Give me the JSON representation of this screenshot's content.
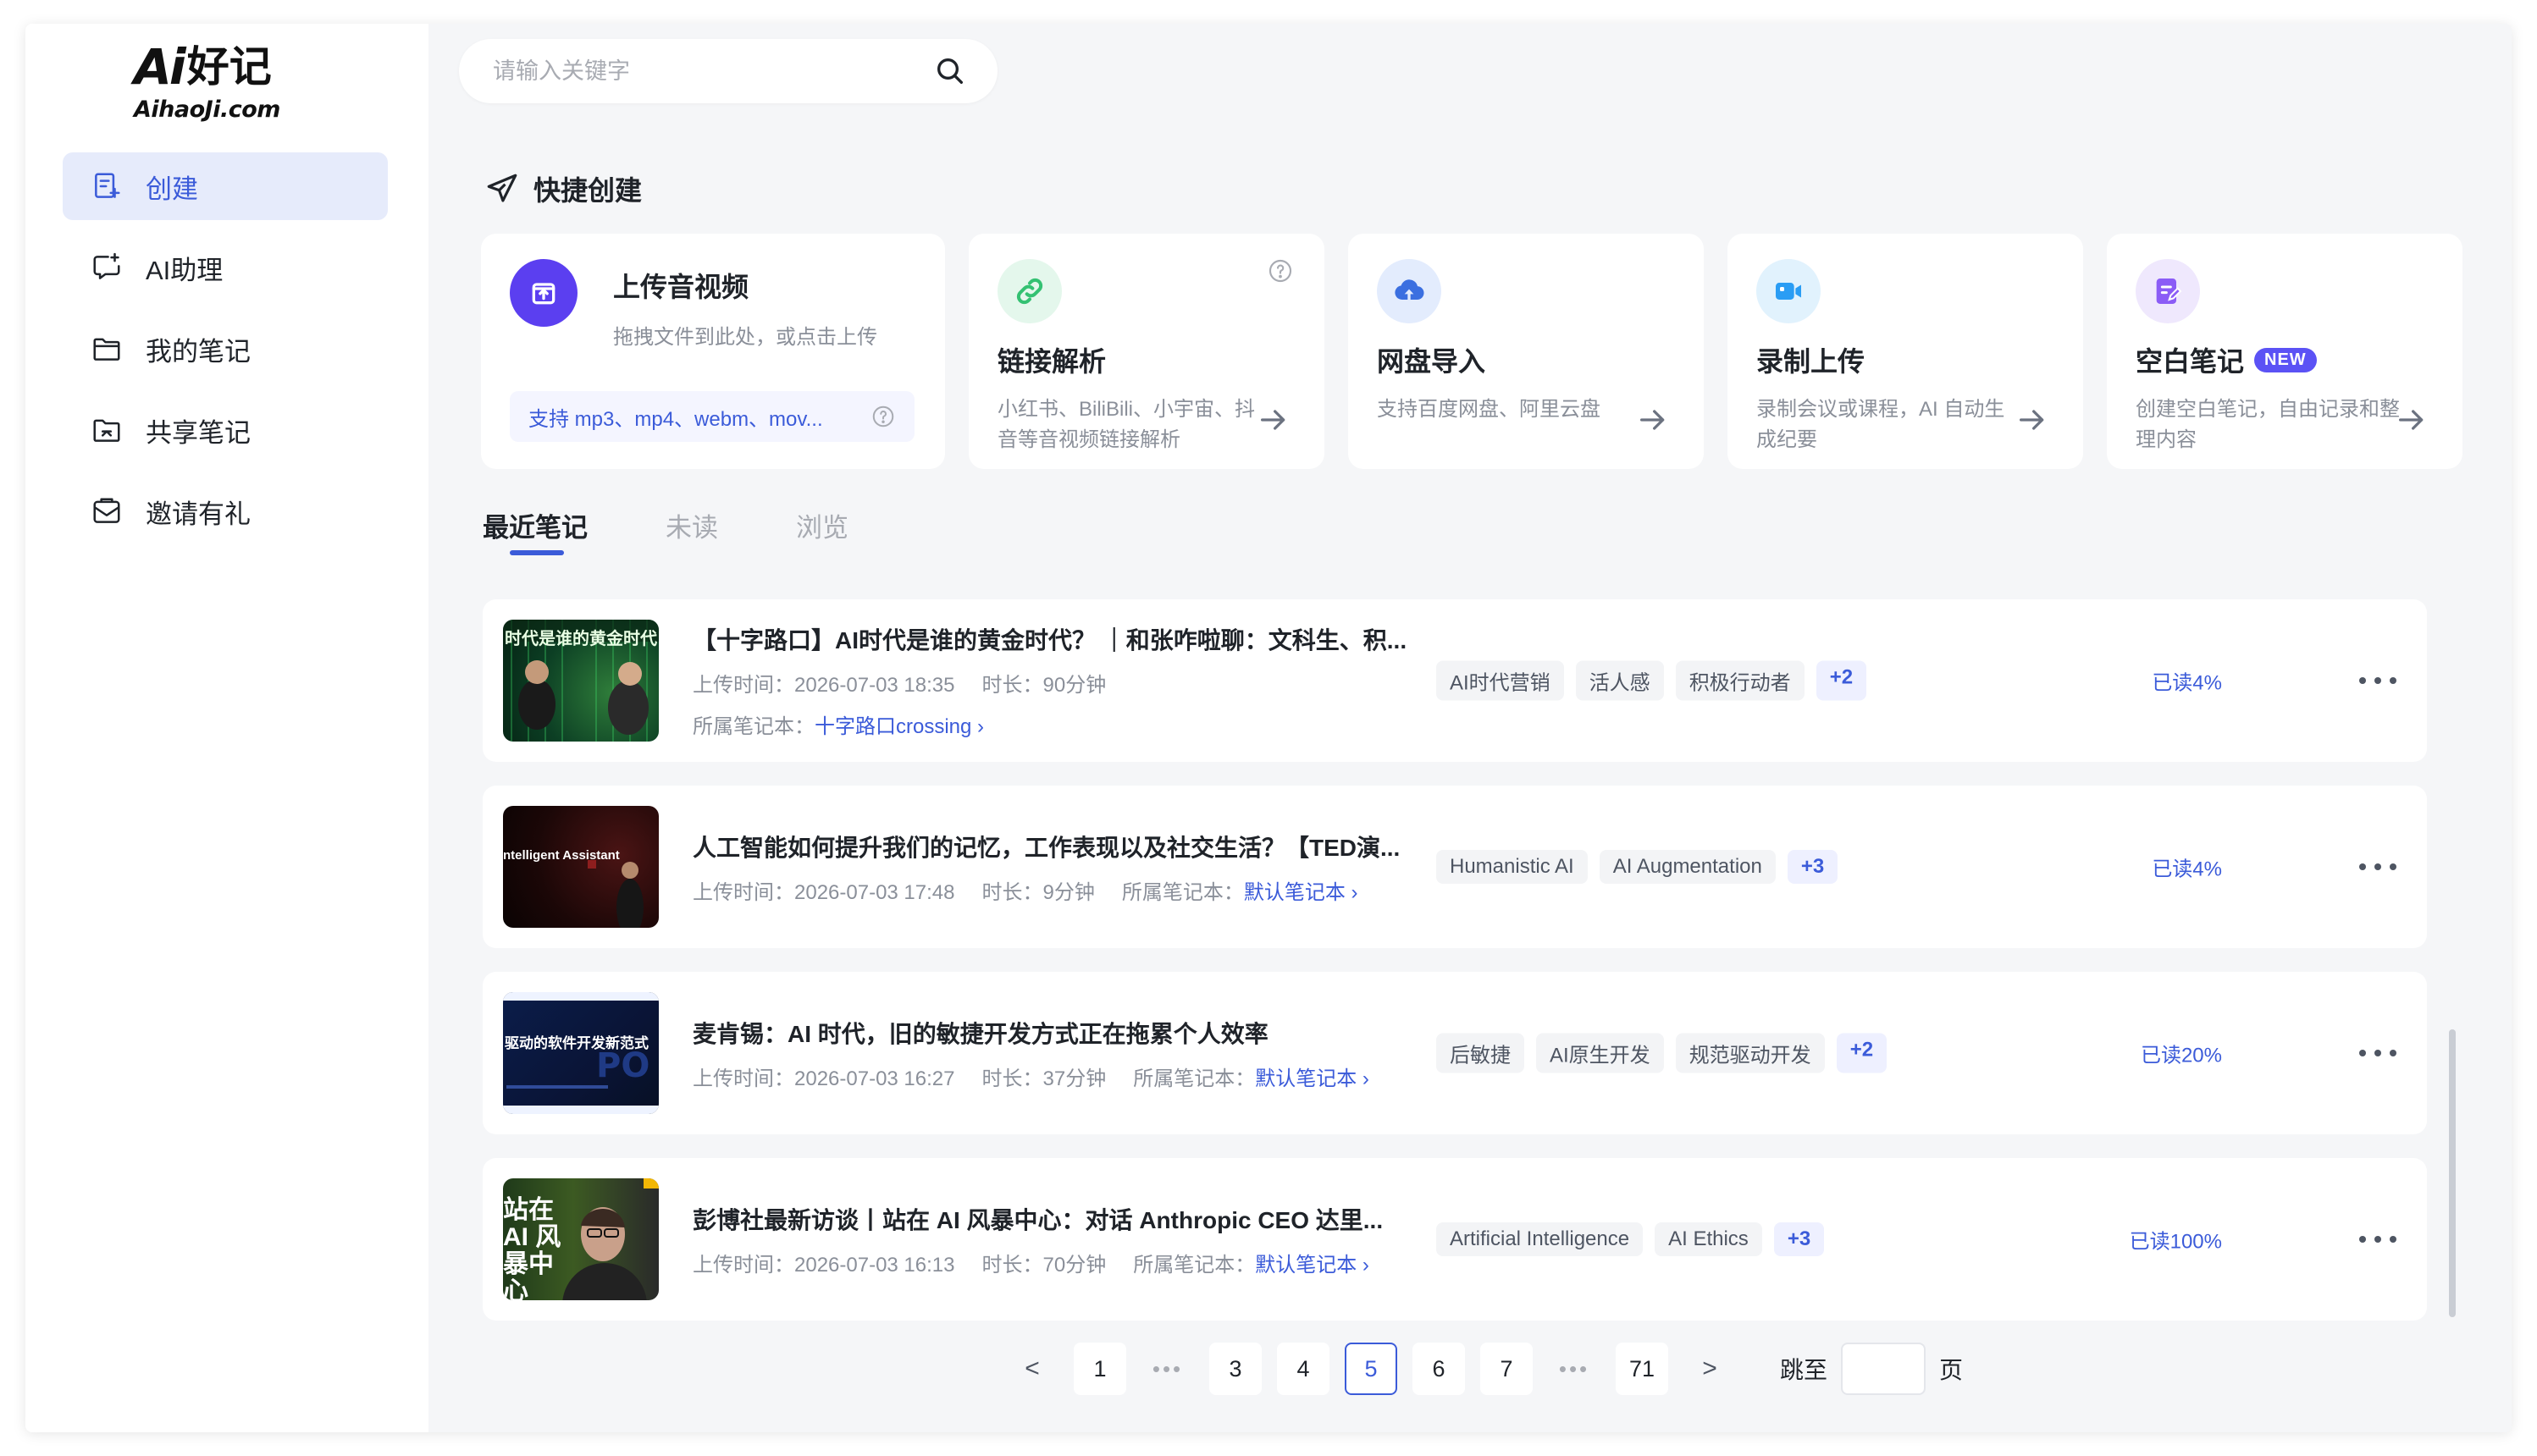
{
  "logo": {
    "brand_ai": "Ai",
    "brand_cn": "好记",
    "domain": "AihaoJi.com"
  },
  "sidebar": {
    "items": [
      {
        "label": "创建",
        "icon": "create-note-icon",
        "active": true
      },
      {
        "label": "AI助理",
        "icon": "ai-chat-icon"
      },
      {
        "label": "我的笔记",
        "icon": "folder-icon"
      },
      {
        "label": "共享笔记",
        "icon": "shared-folder-icon"
      },
      {
        "label": "邀请有礼",
        "icon": "invite-mail-icon"
      }
    ]
  },
  "search": {
    "placeholder": "请输入关键字"
  },
  "quick_create": {
    "title": "快捷创建",
    "upload": {
      "title": "上传音视频",
      "desc": "拖拽文件到此处，或点击上传",
      "formats": "支持 mp3、mp4、webm、mov..."
    },
    "cards": [
      {
        "title": "链接解析",
        "desc": "小红书、BiliBili、小宇宙、抖音等音视频链接解析"
      },
      {
        "title": "网盘导入",
        "desc": "支持百度网盘、阿里云盘"
      },
      {
        "title": "录制上传",
        "desc": "录制会议或课程，AI 自动生成纪要"
      },
      {
        "title": "空白笔记",
        "badge": "NEW",
        "desc": "创建空白笔记，自由记录和整理内容"
      }
    ]
  },
  "tabs": [
    "最近笔记",
    "未读",
    "浏览"
  ],
  "notes": [
    {
      "title": "【十字路口】AI时代是谁的黄金时代？ ｜和张咋啦聊：文科生、积...",
      "upload_label": "上传时间：",
      "upload_time": "2026-07-03 18:35",
      "duration_label": "时长：",
      "duration": "90分钟",
      "notebook_label": "所属笔记本：",
      "notebook": "十字路口crossing",
      "tags": [
        "AI时代营销",
        "活人感",
        "积极行动者"
      ],
      "more_tags": "+2",
      "read": "已读4%",
      "thumb_caption": "时代是谁的黄金时代"
    },
    {
      "title": "人工智能如何提升我们的记忆，工作表现以及社交生活？【TED演...",
      "upload_label": "上传时间：",
      "upload_time": "2026-07-03 17:48",
      "duration_label": "时长：",
      "duration": "9分钟",
      "notebook_label": "所属笔记本：",
      "notebook": "默认笔记本",
      "tags": [
        "Humanistic AI",
        "AI Augmentation"
      ],
      "more_tags": "+3",
      "read": "已读4%",
      "thumb_caption": "ntelligent Assistant"
    },
    {
      "title": "麦肯锡：AI 时代，旧的敏捷开发方式正在拖累个人效率",
      "upload_label": "上传时间：",
      "upload_time": "2026-07-03 16:27",
      "duration_label": "时长：",
      "duration": "37分钟",
      "notebook_label": "所属笔记本：",
      "notebook": "默认笔记本",
      "tags": [
        "后敏捷",
        "AI原生开发",
        "规范驱动开发"
      ],
      "more_tags": "+2",
      "read": "已读20%",
      "thumb_caption": "驱动的软件开发新范式"
    },
    {
      "title": "彭博社最新访谈丨站在 AI 风暴中心：对话 Anthropic CEO 达里...",
      "upload_label": "上传时间：",
      "upload_time": "2026-07-03 16:13",
      "duration_label": "时长：",
      "duration": "70分钟",
      "notebook_label": "所属笔记本：",
      "notebook": "默认笔记本",
      "tags": [
        "Artificial Intelligence",
        "AI Ethics"
      ],
      "more_tags": "+3",
      "read": "已读100%",
      "thumb_caption": "站在 AI 风暴中心"
    }
  ],
  "pagination": {
    "prev": "<",
    "next": ">",
    "pages": [
      "1",
      "•••",
      "3",
      "4",
      "5",
      "6",
      "7",
      "•••",
      "71"
    ],
    "current": "5",
    "jump_label": "跳至",
    "page_suffix": "页"
  },
  "colors": {
    "accent": "#3b5bd9",
    "upload_icon": "#5b3ff0",
    "link_icon": "#34c172",
    "cloud_icon": "#3b6fe0",
    "record_icon": "#2a9df4",
    "blank_icon": "#8b5cf6"
  }
}
